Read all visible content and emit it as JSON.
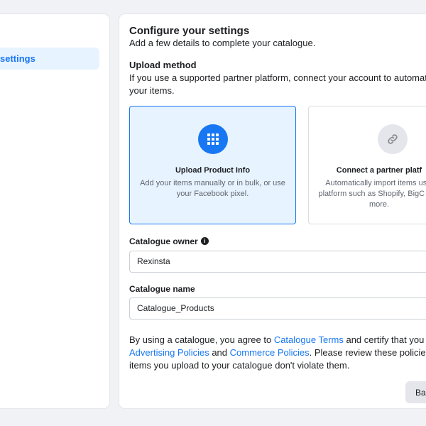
{
  "sidebar": {
    "active_item": "settings"
  },
  "header": {
    "title": "Configure your settings",
    "subtitle": "Add a few details to complete your catalogue."
  },
  "upload_method": {
    "title": "Upload method",
    "description_line1": "If you use a supported partner platform, connect your account to automaticall",
    "description_line2": "your items.",
    "options": [
      {
        "title": "Upload Product Info",
        "description": "Add your items manually or in bulk, or use your Facebook pixel.",
        "icon": "grid-icon",
        "selected": true
      },
      {
        "title": "Connect a partner platf",
        "description": "Automatically import items usin platform such as Shopify, BigC and more.",
        "icon": "link-icon",
        "selected": false
      }
    ]
  },
  "catalogue_owner": {
    "label": "Catalogue owner",
    "value": "Rexinsta"
  },
  "catalogue_name": {
    "label": "Catalogue name",
    "value": "Catalogue_Products"
  },
  "terms": {
    "t1": "By using a catalogue, you agree to ",
    "link1": "Catalogue Terms",
    "t2": " and certify that you are al",
    "link2": "Advertising Policies",
    "t3": " and ",
    "link3": "Commerce Policies",
    "t4": ". Please review these policies and",
    "t5": "items you upload to your catalogue don't violate them."
  },
  "footer": {
    "back_label": "Back"
  },
  "colors": {
    "accent": "#1877f2",
    "selected_bg": "#e7f3ff",
    "page_bg": "#f0f2f5"
  }
}
